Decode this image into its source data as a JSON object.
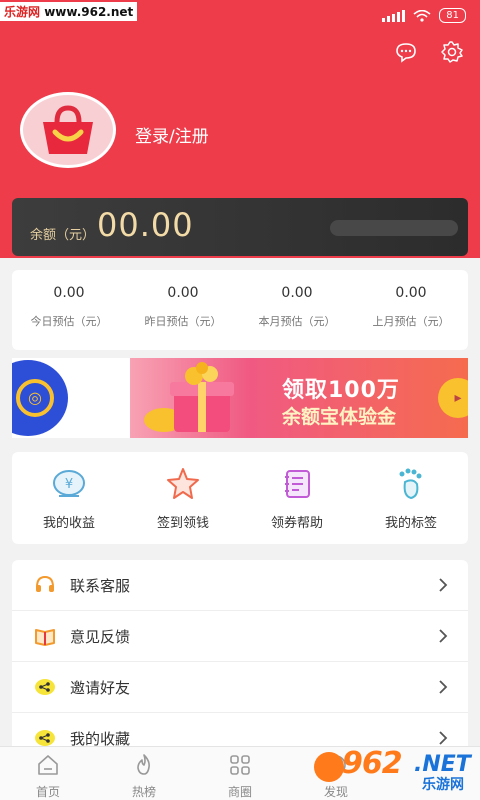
{
  "status_bar": {
    "watermark_site": "乐游网",
    "watermark_url": "www.962.net",
    "battery": "81"
  },
  "header": {
    "login_label": "登录/注册",
    "icons": [
      "message-icon",
      "settings-icon"
    ]
  },
  "balance": {
    "label": "余额（元）",
    "value": "00.00"
  },
  "stats": [
    {
      "value": "0.00",
      "label": "今日预估（元）"
    },
    {
      "value": "0.00",
      "label": "昨日预估（元）"
    },
    {
      "value": "0.00",
      "label": "本月预估（元）"
    },
    {
      "value": "0.00",
      "label": "上月预估（元）"
    }
  ],
  "banner": {
    "title": "领取100万",
    "subtitle": "余额宝体验金"
  },
  "quick_actions": [
    {
      "label": "我的收益",
      "icon": "wallet-icon"
    },
    {
      "label": "签到领钱",
      "icon": "star-icon"
    },
    {
      "label": "领券帮助",
      "icon": "notebook-icon"
    },
    {
      "label": "我的标签",
      "icon": "footprint-icon"
    }
  ],
  "menu": [
    {
      "label": "联系客服",
      "icon": "headset-icon"
    },
    {
      "label": "意见反馈",
      "icon": "book-icon"
    },
    {
      "label": "邀请好友",
      "icon": "share-icon"
    },
    {
      "label": "我的收藏",
      "icon": "favorite-icon"
    }
  ],
  "tabbar": [
    {
      "label": "首页",
      "icon": "home-icon"
    },
    {
      "label": "热榜",
      "icon": "fire-icon"
    },
    {
      "label": "商圈",
      "icon": "grid-icon"
    },
    {
      "label": "发现",
      "icon": "discover-icon"
    }
  ],
  "watermark_logo": {
    "number": "962",
    "net": ".NET",
    "name": "乐游网"
  },
  "colors": {
    "header_red": "#ee3c4a",
    "gold_text": "#f3dba8",
    "card_dark": "#2c2c2c"
  }
}
